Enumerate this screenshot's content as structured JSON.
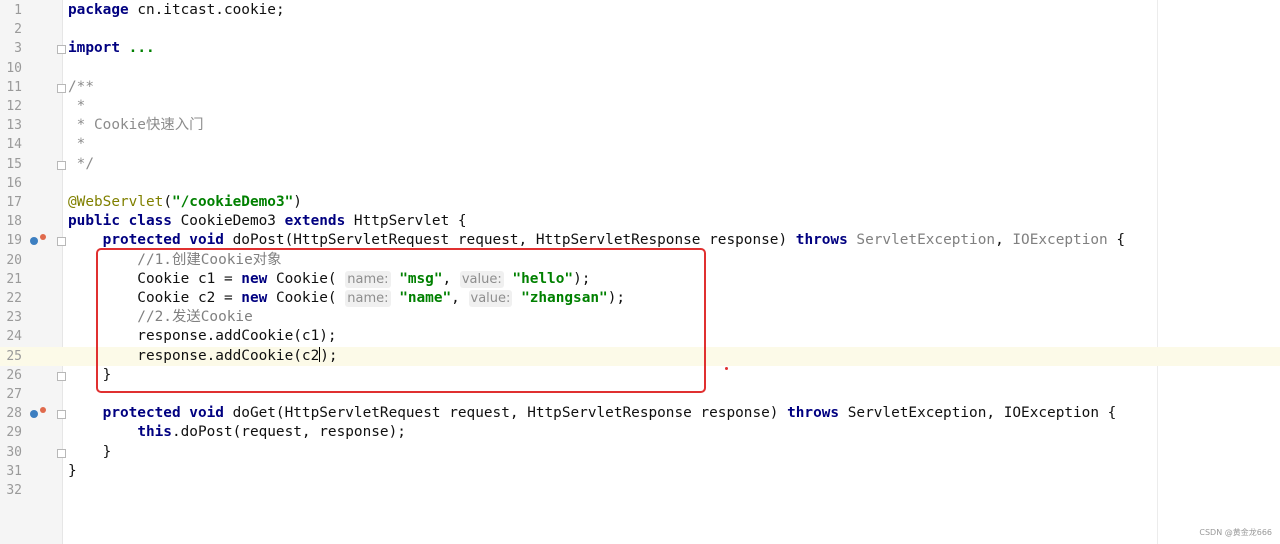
{
  "editor": {
    "lines": [
      {
        "num": "1",
        "tokens": [
          {
            "t": "package",
            "c": "kw"
          },
          {
            "t": " cn.itcast.cookie;",
            "c": ""
          }
        ]
      },
      {
        "num": "2",
        "tokens": []
      },
      {
        "num": "3",
        "tokens": [
          {
            "t": "import",
            "c": "kw"
          },
          {
            "t": " ",
            "c": ""
          },
          {
            "t": "...",
            "c": "str"
          }
        ]
      },
      {
        "num": "10",
        "tokens": []
      },
      {
        "num": "11",
        "tokens": [
          {
            "t": "/**",
            "c": "cm"
          }
        ]
      },
      {
        "num": "12",
        "tokens": [
          {
            "t": " *",
            "c": "cm"
          }
        ]
      },
      {
        "num": "13",
        "tokens": [
          {
            "t": " * Cookie快速入门",
            "c": "cm"
          }
        ]
      },
      {
        "num": "14",
        "tokens": [
          {
            "t": " *",
            "c": "cm"
          }
        ]
      },
      {
        "num": "15",
        "tokens": [
          {
            "t": " */",
            "c": "cm"
          }
        ]
      },
      {
        "num": "16",
        "tokens": []
      },
      {
        "num": "17",
        "tokens": [
          {
            "t": "@WebServlet",
            "c": "ann"
          },
          {
            "t": "(",
            "c": ""
          },
          {
            "t": "\"/cookieDemo3\"",
            "c": "str"
          },
          {
            "t": ")",
            "c": ""
          }
        ]
      },
      {
        "num": "18",
        "tokens": [
          {
            "t": "public class",
            "c": "kw"
          },
          {
            "t": " CookieDemo3 ",
            "c": ""
          },
          {
            "t": "extends",
            "c": "kw"
          },
          {
            "t": " HttpServlet {",
            "c": ""
          }
        ]
      },
      {
        "num": "19",
        "tokens": [
          {
            "t": "    ",
            "c": ""
          },
          {
            "t": "protected void",
            "c": "kw"
          },
          {
            "t": " doPost(HttpServletRequest request, HttpServletResponse response) ",
            "c": ""
          },
          {
            "t": "throws",
            "c": "kw"
          },
          {
            "t": " ServletException",
            "c": "gray"
          },
          {
            "t": ", ",
            "c": ""
          },
          {
            "t": "IOException",
            "c": "gray"
          },
          {
            "t": " {",
            "c": ""
          }
        ]
      },
      {
        "num": "20",
        "tokens": [
          {
            "t": "        //1.创建Cookie对象",
            "c": "lc"
          }
        ]
      },
      {
        "num": "21",
        "tokens": [
          {
            "t": "        Cookie c1 = ",
            "c": ""
          },
          {
            "t": "new",
            "c": "kw"
          },
          {
            "t": " Cookie( ",
            "c": ""
          },
          {
            "t": "name:",
            "c": "hint"
          },
          {
            "t": " ",
            "c": ""
          },
          {
            "t": "\"msg\"",
            "c": "str"
          },
          {
            "t": ", ",
            "c": ""
          },
          {
            "t": "value:",
            "c": "hint"
          },
          {
            "t": " ",
            "c": ""
          },
          {
            "t": "\"hello\"",
            "c": "str"
          },
          {
            "t": ");",
            "c": ""
          }
        ]
      },
      {
        "num": "22",
        "tokens": [
          {
            "t": "        Cookie c2 = ",
            "c": ""
          },
          {
            "t": "new",
            "c": "kw"
          },
          {
            "t": " Cookie( ",
            "c": ""
          },
          {
            "t": "name:",
            "c": "hint"
          },
          {
            "t": " ",
            "c": ""
          },
          {
            "t": "\"name\"",
            "c": "str"
          },
          {
            "t": ", ",
            "c": ""
          },
          {
            "t": "value:",
            "c": "hint"
          },
          {
            "t": " ",
            "c": ""
          },
          {
            "t": "\"zhangsan\"",
            "c": "str"
          },
          {
            "t": ");",
            "c": ""
          }
        ]
      },
      {
        "num": "23",
        "tokens": [
          {
            "t": "        //2.发送Cookie",
            "c": "lc"
          }
        ]
      },
      {
        "num": "24",
        "tokens": [
          {
            "t": "        response.addCookie(c1);",
            "c": ""
          }
        ]
      },
      {
        "num": "25",
        "tokens": [
          {
            "t": "        response.addCookie(c2",
            "c": ""
          },
          {
            "t": "|",
            "c": "caret"
          },
          {
            "t": ");",
            "c": ""
          }
        ]
      },
      {
        "num": "26",
        "tokens": [
          {
            "t": "    }",
            "c": ""
          }
        ]
      },
      {
        "num": "27",
        "tokens": []
      },
      {
        "num": "28",
        "tokens": [
          {
            "t": "    ",
            "c": ""
          },
          {
            "t": "protected void",
            "c": "kw"
          },
          {
            "t": " doGet(HttpServletRequest request, HttpServletResponse response) ",
            "c": ""
          },
          {
            "t": "throws",
            "c": "kw"
          },
          {
            "t": " ServletException, IOException {",
            "c": ""
          }
        ]
      },
      {
        "num": "29",
        "tokens": [
          {
            "t": "        ",
            "c": ""
          },
          {
            "t": "this",
            "c": "kw"
          },
          {
            "t": ".doPost(request, response);",
            "c": ""
          }
        ]
      },
      {
        "num": "30",
        "tokens": [
          {
            "t": "    }",
            "c": ""
          }
        ]
      },
      {
        "num": "31",
        "tokens": [
          {
            "t": "}",
            "c": ""
          }
        ]
      },
      {
        "num": "32",
        "tokens": []
      }
    ],
    "current_line": "25",
    "override_markers": [
      "19",
      "28"
    ],
    "fold_markers": [
      "3",
      "11",
      "15",
      "19",
      "26",
      "28",
      "30"
    ]
  },
  "watermark": "CSDN @黄金龙666"
}
